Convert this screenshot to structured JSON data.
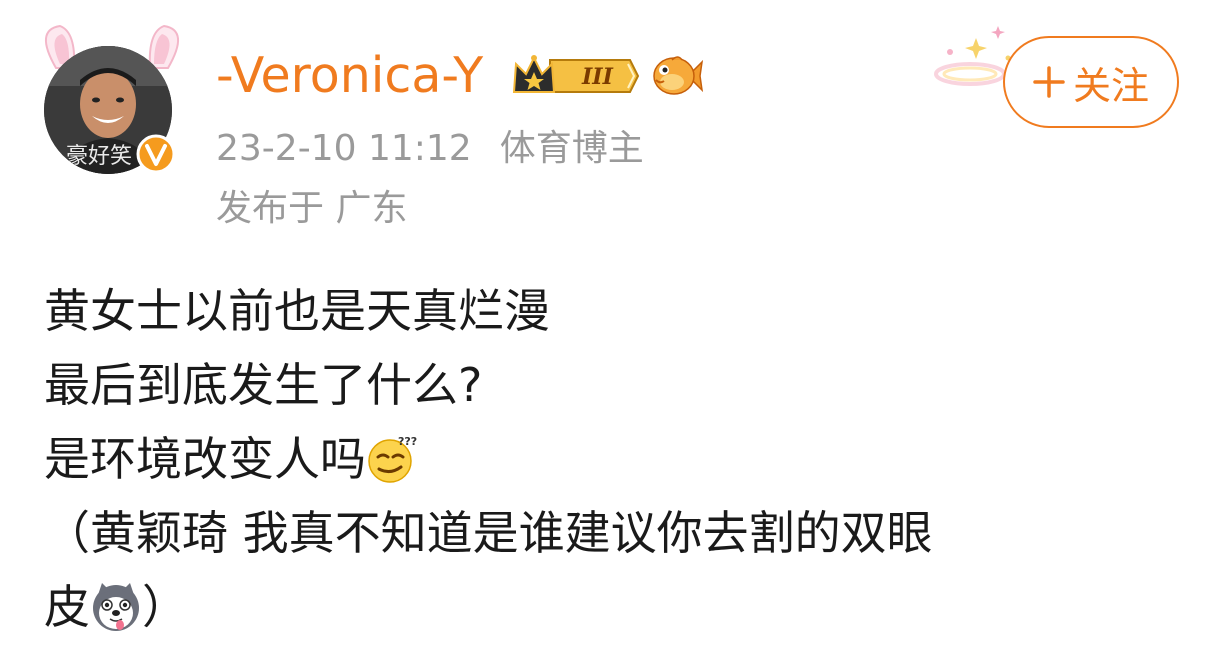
{
  "post": {
    "avatar_watermark": "豪好笑",
    "username": "-Veronica-Y",
    "crown_badge_level": "III",
    "timestamp": "23-2-10 11:12",
    "role": "体育博主",
    "location": "发布于 广东",
    "follow_label": "关注",
    "lines": {
      "l1": "黄女士以前也是天真烂漫",
      "l2": "最后到底发生了什么?",
      "l3": "是环境改变人吗",
      "l4": "（黄颖琦 我真不知道是谁建议你去割的双眼",
      "l5a": "皮",
      "l5b": "）"
    }
  },
  "icons": {
    "avatar": "avatar-photo",
    "verified": "verified-v-icon",
    "crown": "crown-level-icon",
    "fish": "fish-icon",
    "ears": "bunny-ears-icon",
    "sparkle": "sparkle-icon",
    "plus": "plus-icon",
    "emoji1": "confused-face-emoji",
    "emoji2": "husky-dog-emoji"
  },
  "colors": {
    "accent": "#f07b1f",
    "meta": "#9a9a9a",
    "text": "#1a1a1a"
  }
}
